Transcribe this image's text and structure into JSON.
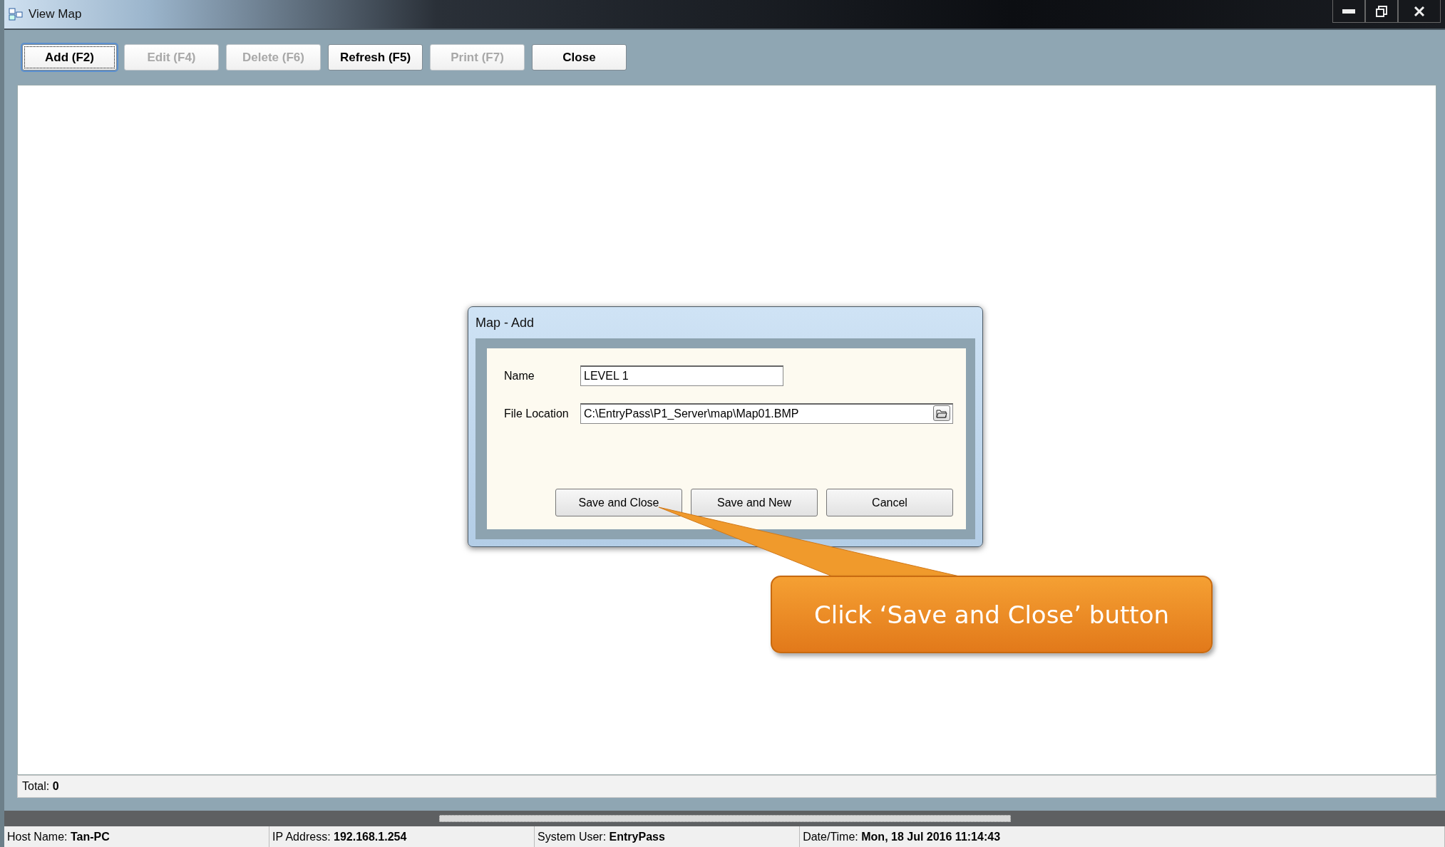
{
  "window": {
    "title": "View Map"
  },
  "toolbar": [
    {
      "label": "Add (F2)",
      "disabled": false,
      "focused": true
    },
    {
      "label": "Edit (F4)",
      "disabled": true,
      "focused": false
    },
    {
      "label": "Delete (F6)",
      "disabled": true,
      "focused": false
    },
    {
      "label": "Refresh (F5)",
      "disabled": false,
      "focused": false
    },
    {
      "label": "Print (F7)",
      "disabled": true,
      "focused": false
    },
    {
      "label": "Close",
      "disabled": false,
      "focused": false
    }
  ],
  "dialog": {
    "title": "Map - Add",
    "fields": [
      {
        "kind": "text",
        "label": "Name",
        "value": "LEVEL 1"
      },
      {
        "kind": "file",
        "label": "File Location",
        "value": "C:\\EntryPass\\P1_Server\\map\\Map01.BMP"
      }
    ],
    "buttons": [
      "Save and Close",
      "Save and New",
      "Cancel"
    ]
  },
  "callout": {
    "text": "Click ‘Save and Close’ button"
  },
  "total": {
    "label": "Total:",
    "value": "0"
  },
  "status_bar": [
    {
      "label": "Host Name:",
      "value": "Tan-PC"
    },
    {
      "label": "IP Address:",
      "value": "192.168.1.254"
    },
    {
      "label": "System User:",
      "value": "EntryPass"
    },
    {
      "label": "Date/Time:",
      "value": "Mon, 18 Jul 2016 11:14:43"
    }
  ]
}
